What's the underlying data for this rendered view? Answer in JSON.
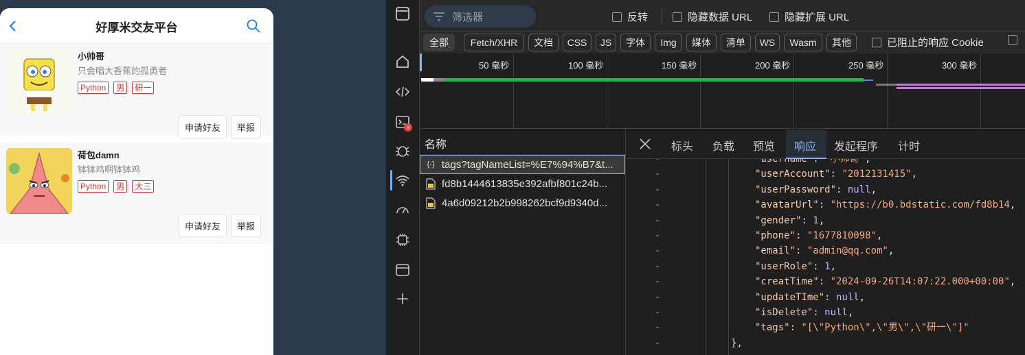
{
  "app": {
    "title": "好厚米交友平台",
    "back_icon": "chevron-left-icon",
    "search_icon": "search-icon",
    "users": [
      {
        "username": "小帅哥",
        "profile": "只会唱大香蕉的孤勇者",
        "tags": [
          "Python",
          "男",
          "研一"
        ],
        "add_friend": "申请好友",
        "report": "举报",
        "avatar": "spongebob-avatar"
      },
      {
        "username": "荷包damn",
        "profile": "钵钵鸡啊钵钵鸡",
        "tags": [
          "Python",
          "男",
          "大三"
        ],
        "add_friend": "申请好友",
        "report": "举报",
        "avatar": "patrick-avatar"
      }
    ]
  },
  "devtools": {
    "filter_placeholder": "筛选器",
    "checks": [
      "反转",
      "隐藏数据 URL",
      "隐藏扩展 URL",
      "已阻止的响应 Cookie"
    ],
    "types": [
      "全部",
      "Fetch/XHR",
      "文档",
      "CSS",
      "JS",
      "字体",
      "Img",
      "媒体",
      "清单",
      "WS",
      "Wasm",
      "其他"
    ],
    "active_type": "全部",
    "ticks": [
      "50 毫秒",
      "100 毫秒",
      "150 毫秒",
      "200 毫秒",
      "250 毫秒",
      "300 毫秒"
    ],
    "name_header": "名称",
    "requests": [
      {
        "name": "tags?tagNameList=%E7%94%B7&t...",
        "icon": "fetch-icon"
      },
      {
        "name": "fd8b1444613835e392afbf801c24b...",
        "icon": "image-file-icon"
      },
      {
        "name": "4a6d09212b2b998262bcf9d9340d...",
        "icon": "image-file-icon"
      }
    ],
    "detail_tabs": [
      "标头",
      "负载",
      "预览",
      "响应",
      "发起程序",
      "计时"
    ],
    "active_detail_tab": "响应",
    "response_lines": [
      {
        "key": "\"username\"",
        "val": "\"小帅哥\"",
        "type": "string"
      },
      {
        "key": "\"userAccount\"",
        "val": "\"2012131415\"",
        "type": "string"
      },
      {
        "key": "\"userPassword\"",
        "val": "null",
        "type": "literal"
      },
      {
        "key": "\"avatarUrl\"",
        "val": "\"https://b0.bdstatic.com/fd8b14",
        "type": "string"
      },
      {
        "key": "\"gender\"",
        "val": "1",
        "type": "number"
      },
      {
        "key": "\"phone\"",
        "val": "\"1677810098\"",
        "type": "string"
      },
      {
        "key": "\"email\"",
        "val": "\"admin@qq.com\"",
        "type": "string"
      },
      {
        "key": "\"userRole\"",
        "val": "1",
        "type": "number"
      },
      {
        "key": "\"creatTime\"",
        "val": "\"2024-09-26T14:07:22.000+00:00\"",
        "type": "string"
      },
      {
        "key": "\"updateTIme\"",
        "val": "null",
        "type": "literal"
      },
      {
        "key": "\"isDelete\"",
        "val": "null",
        "type": "literal"
      },
      {
        "key": "\"tags\"",
        "val": "\"[\\\"Python\\\",\\\"男\\\",\\\"研一\\\"]\"",
        "type": "string"
      }
    ],
    "closing_line": "},",
    "gutter_mark": "-"
  }
}
